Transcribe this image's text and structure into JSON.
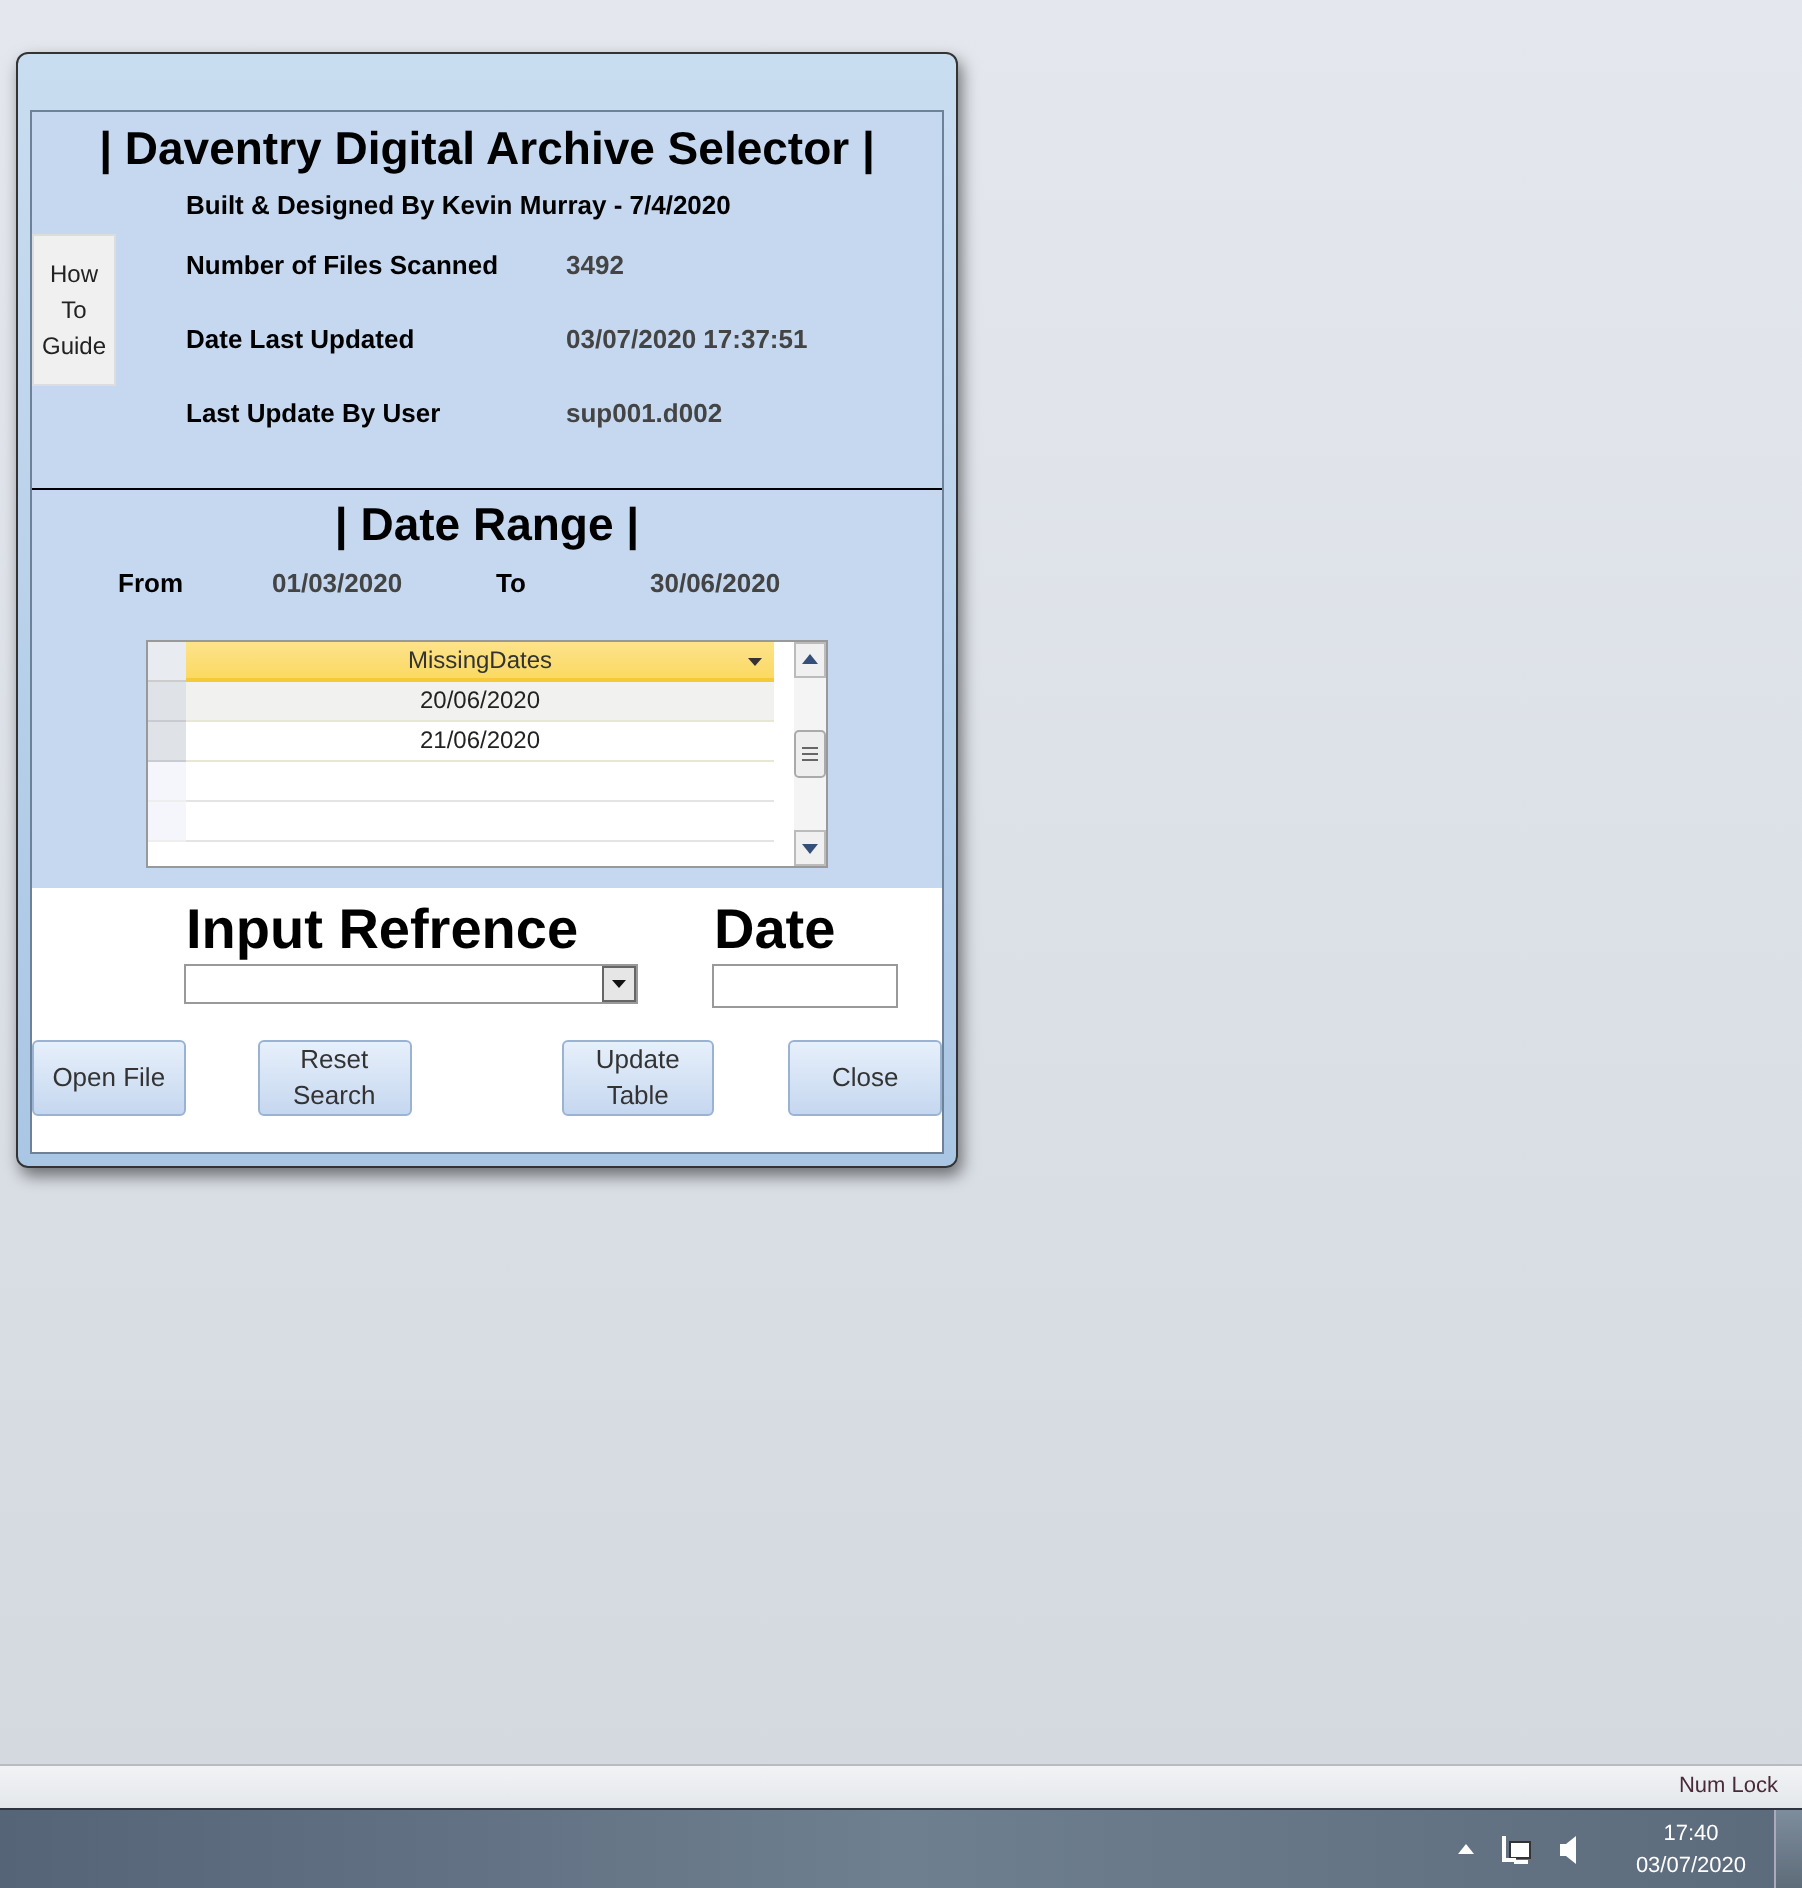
{
  "form": {
    "title": "| Daventry Digital Archive Selector |",
    "credit": "Built & Designed By Kevin Murray - 7/4/2020",
    "guide_button": "How To Guide",
    "info": [
      {
        "label": "Number of Files Scanned",
        "value": "3492"
      },
      {
        "label": "Date Last Updated",
        "value": "03/07/2020 17:37:51"
      },
      {
        "label": "Last Update By User",
        "value": "sup001.d002"
      }
    ],
    "date_range": {
      "title": "| Date Range |",
      "from_label": "From",
      "from": "01/03/2020",
      "to_label": "To",
      "to": "30/06/2020"
    },
    "table": {
      "column": "MissingDates",
      "rows": [
        {
          "value": "20/06/2020",
          "selected": true
        },
        {
          "value": "21/06/2020",
          "selected": false
        }
      ]
    },
    "reference_label": "Input Refrence",
    "date_label": "Date",
    "buttons": [
      "Open File",
      "Reset Search",
      "Update Table",
      "Close"
    ]
  },
  "status_bar": {
    "num_lock": "Num Lock"
  },
  "taskbar": {
    "time": "17:40",
    "date": "03/07/2020"
  }
}
